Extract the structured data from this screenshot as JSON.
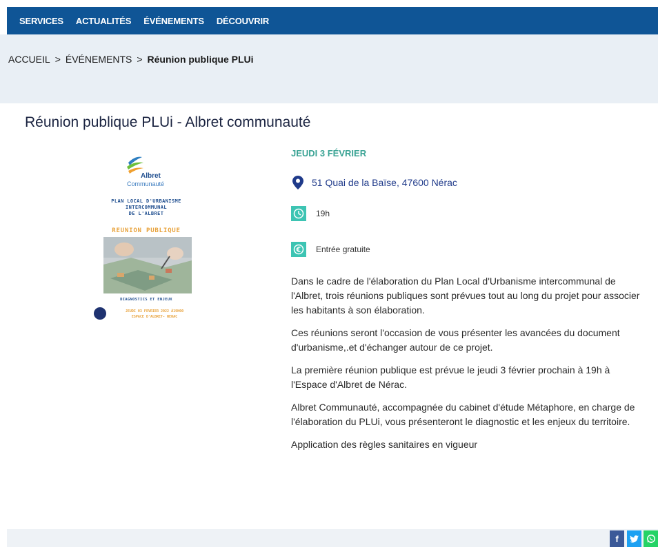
{
  "nav": {
    "items": [
      "SERVICES",
      "ACTUALITÉS",
      "ÉVÉNEMENTS",
      "DÉCOUVRIR"
    ]
  },
  "breadcrumb": {
    "items": [
      "ACCUEIL",
      "ÉVÉNEMENTS"
    ],
    "current": "Réunion publique PLUi",
    "separator": ">"
  },
  "event": {
    "title": "Réunion publique PLUi - Albret communauté",
    "date": "JEUDI 3 FÉVRIER",
    "address": "51 Quai de la Baïse, 47600 Nérac",
    "time": "19h",
    "price": "Entrée gratuite",
    "paragraphs": [
      "Dans le cadre de l'élaboration du Plan Local d'Urbanisme intercommunal de l'Albret, trois réunions publiques sont prévues tout au long du projet pour associer les habitants à son élaboration.",
      "Ces réunions seront l'occasion de vous présenter les avancées du document d'urbanisme,.et d'échanger autour de ce projet.",
      "La première réunion publique est prévue le jeudi 3 février prochain à 19h à l'Espace d'Albret de Nérac.",
      "Albret Communauté, accompagnée du cabinet d'étude Métaphore, en charge de l'élaboration du PLUi, vous présenteront le diagnostic et les enjeux du territoire.",
      "Application des règles sanitaires en vigueur"
    ]
  },
  "poster": {
    "logo_name": "Albret",
    "logo_sub": "Communauté",
    "plan_lines": [
      "PLAN LOCAL D'URBANISME",
      "INTERCOMMUNAL",
      "DE L'ALBRET"
    ],
    "headline": "REUNION PUBLIQUE",
    "subheading": "DIAGNOSTICS ET ENJEUX",
    "date_lines": [
      "JEUDI 03 FEVRIER 2022 À19H00",
      "ESPACE D'ALBRET- NERAC"
    ]
  },
  "share": {
    "facebook": "f",
    "twitter": "t",
    "whatsapp": "w"
  },
  "icons": {
    "address": "map-pin-icon",
    "time": "clock-icon",
    "price": "euro-icon"
  },
  "colors": {
    "nav_bg": "#0f5596",
    "accent_teal": "#3dc4b3",
    "date_green": "#3aa394",
    "address_blue": "#1f3a8a",
    "band_bg": "#e9eff5"
  }
}
